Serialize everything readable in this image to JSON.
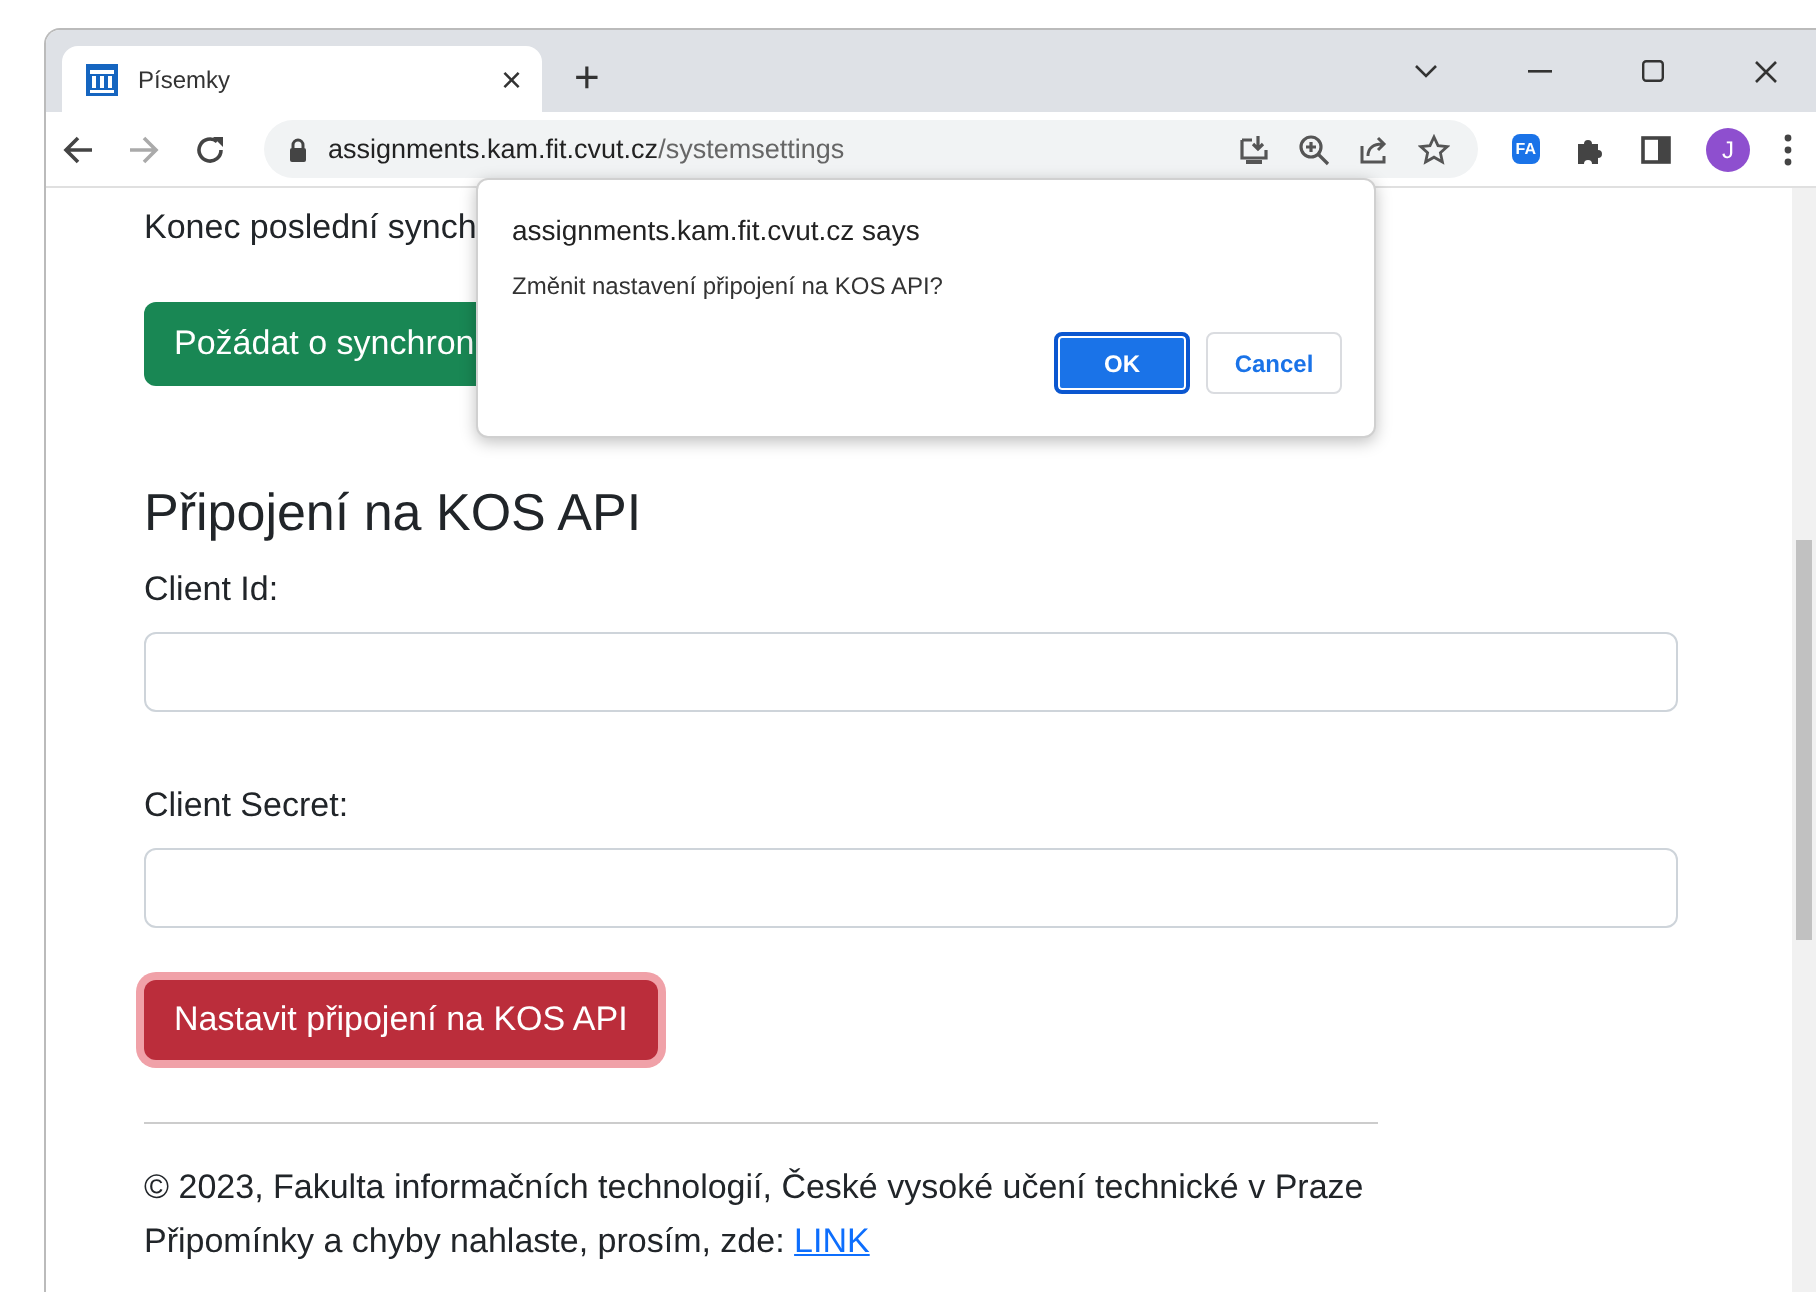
{
  "browser": {
    "tab": {
      "title": "Písemky",
      "close": "×"
    },
    "new_tab": "+",
    "url_host": "assignments.kam.fit.cvut.cz",
    "url_path": "/systemsettings",
    "extension_badge": "FA",
    "profile_initial": "J"
  },
  "page": {
    "sync_text": "Konec poslední synch",
    "sync_button": "Požádat o synchron",
    "heading": "Připojení na KOS API",
    "fields": [
      {
        "label": "Client Id:"
      },
      {
        "label": "Client Secret:"
      }
    ],
    "submit_button": "Nastavit připojení na KOS API",
    "footer": {
      "copyright": "© 2023, Fakulta informačních technologií, České vysoké učení technické v Praze",
      "feedback": "Připomínky a chyby nahlaste, prosím, zde: ",
      "link": "LINK"
    }
  },
  "dialog": {
    "title": "assignments.kam.fit.cvut.cz says",
    "message": "Změnit nastavení připojení na KOS API?",
    "buttons": [
      {
        "label": "OK",
        "kind": "primary"
      },
      {
        "label": "Cancel",
        "kind": "secondary"
      }
    ]
  }
}
